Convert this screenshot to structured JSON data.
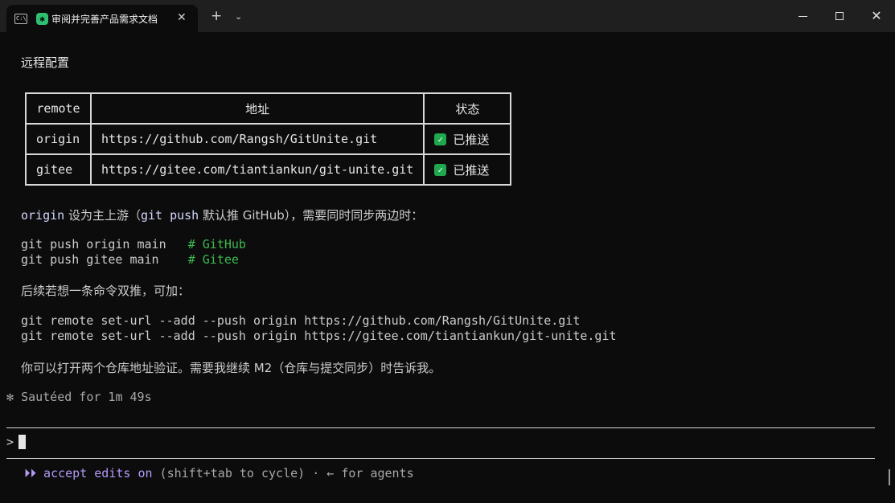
{
  "window": {
    "tab_title": "审阅并完善产品需求文档",
    "tab_close": "✕",
    "new_tab": "+",
    "dropdown": "⌄",
    "close": "✕"
  },
  "content": {
    "heading": "远程配置",
    "table": {
      "headers": [
        "remote",
        "地址",
        "状态"
      ],
      "rows": [
        {
          "remote": "origin",
          "url": "https://github.com/Rangsh/GitUnite.git",
          "status": "已推送"
        },
        {
          "remote": "gitee",
          "url": "https://gitee.com/tiantiankun/git-unite.git",
          "status": "已推送"
        }
      ]
    },
    "upstream_note": {
      "origin": "origin",
      "t1": " 设为主上游（",
      "cmd": "git push",
      "t2": " 默认推 GitHub），需要同时同步两边时："
    },
    "push_cmds": [
      {
        "cmd": "git push origin main   ",
        "comment": "# GitHub"
      },
      {
        "cmd": "git push gitee main    ",
        "comment": "# Gitee"
      }
    ],
    "followup": "后续若想一条命令双推，可加：",
    "set_url_cmds": [
      "git remote set-url --add --push origin https://github.com/Rangsh/GitUnite.git",
      "git remote set-url --add --push origin https://gitee.com/tiantiankun/git-unite.git"
    ],
    "closing": "你可以打开两个仓库地址验证。需要我继续 M2（仓库与提交同步）时告诉我。",
    "status_line": {
      "icon": "✻",
      "text": "Sautéed for 1m 49s"
    }
  },
  "prompt": {
    "symbol": ">"
  },
  "footer": {
    "arrows": "⏵⏵",
    "accept": "accept edits on",
    "hint": " (shift+tab to cycle) · ← for agents"
  }
}
